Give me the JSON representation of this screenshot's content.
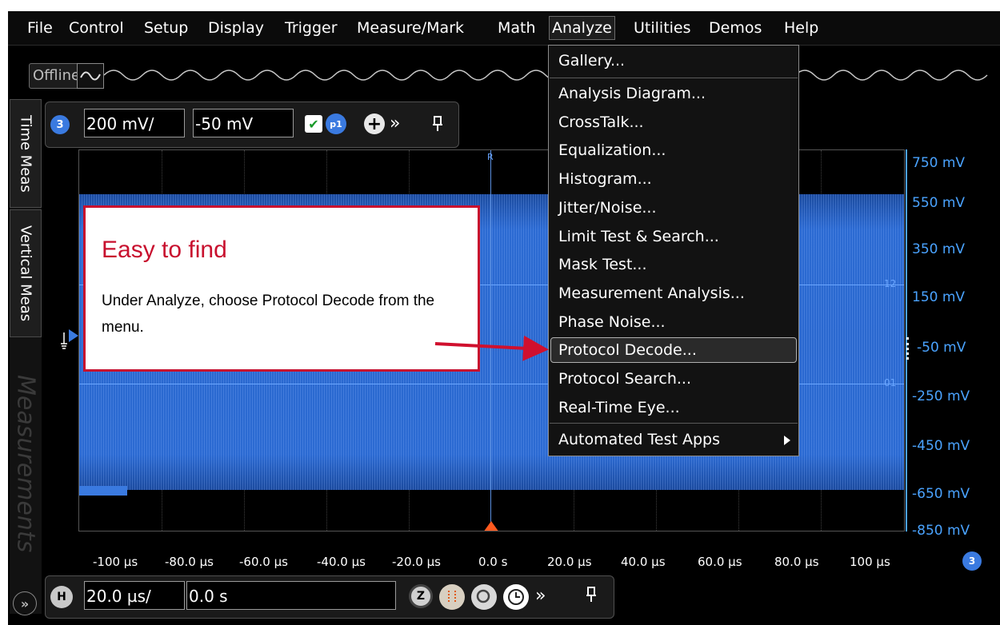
{
  "menubar": {
    "items": [
      "File",
      "Control",
      "Setup",
      "Display",
      "Trigger",
      "Measure/Mark",
      "Math",
      "Analyze",
      "Utilities",
      "Demos",
      "Help"
    ]
  },
  "status": {
    "offline_label": "Offline"
  },
  "side_tabs": {
    "time_meas": "Time Meas",
    "vertical_meas": "Vertical Meas",
    "measurements_ghost": "Measurements"
  },
  "channel_toolbar": {
    "channel_badge": "3",
    "scale_value": "200 mV/",
    "offset_value": "-50 mV",
    "probe_badge": "p1"
  },
  "horizontal_toolbar": {
    "h_badge": "H",
    "timebase_value": "20.0 µs/",
    "position_value": "0.0 s",
    "zoom_badge": "Z"
  },
  "plot": {
    "y_labels": [
      "750 mV",
      "550 mV",
      "350 mV",
      "150 mV",
      "-50 mV",
      "-250 mV",
      "-450 mV",
      "-650 mV",
      "-850 mV"
    ],
    "x_labels": [
      "-100 µs",
      "-80.0 µs",
      "-60.0 µs",
      "-40.0 µs",
      "-20.0 µs",
      "0.0 s",
      "20.0 µs",
      "40.0 µs",
      "60.0 µs",
      "80.0 µs",
      "100 µs"
    ],
    "marker_12": "12",
    "marker_01": "01",
    "marker_r": "R",
    "channel_corner_badge": "3",
    "waveform_color": "#2a68cf"
  },
  "analyze_menu": {
    "items": [
      "Gallery...",
      "Analysis Diagram...",
      "CrossTalk...",
      "Equalization...",
      "Histogram...",
      "Jitter/Noise...",
      "Limit Test & Search...",
      "Mask Test...",
      "Measurement Analysis...",
      "Phase Noise...",
      "Protocol Decode...",
      "Protocol Search...",
      "Real-Time Eye...",
      "Automated Test Apps"
    ],
    "highlighted": "Protocol Decode..."
  },
  "callout": {
    "title": "Easy to find",
    "body": "Under Analyze, choose Protocol Decode from the menu.",
    "accent_color": "#c8102e"
  }
}
